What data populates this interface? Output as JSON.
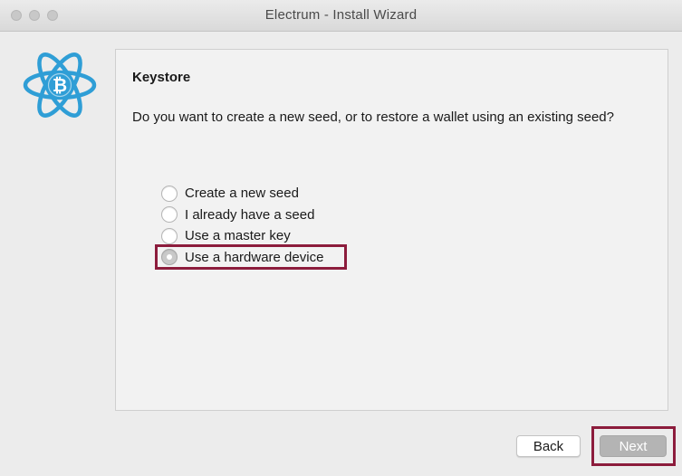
{
  "window": {
    "title": "Electrum  -  Install Wizard"
  },
  "logo": {
    "icon": "electrum-bitcoin-logo-icon",
    "color": "#2f9ed6"
  },
  "panel": {
    "heading": "Keystore",
    "question": "Do you want to create a new seed, or to restore a wallet using an existing seed?",
    "options": [
      {
        "label": "Create a new seed",
        "selected": false
      },
      {
        "label": "I already have a seed",
        "selected": false
      },
      {
        "label": "Use a master key",
        "selected": false
      },
      {
        "label": "Use a hardware device",
        "selected": true
      }
    ]
  },
  "buttons": {
    "back_label": "Back",
    "next_label": "Next"
  },
  "colors": {
    "highlight": "#8c1c3c",
    "window_bg": "#ececec",
    "panel_bg": "#f2f2f2"
  }
}
